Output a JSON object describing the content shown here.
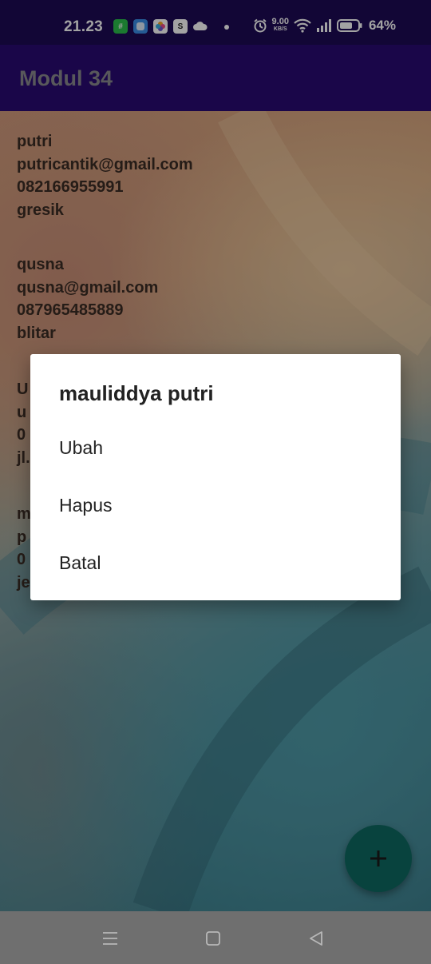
{
  "status_bar": {
    "time": "21.23",
    "net_speed_value": "9.00",
    "net_speed_unit": "KB/S",
    "battery_percent": "64%",
    "icons": [
      "app-green-icon",
      "app-blue-icon",
      "photos-icon",
      "shop-icon",
      "cloud-icon",
      "alarm-icon",
      "wifi-icon",
      "signal-icon",
      "battery-icon"
    ]
  },
  "app_bar": {
    "title": "Modul 34"
  },
  "contacts": [
    {
      "name": "putri",
      "email": "putricantik@gmail.com",
      "phone": "082166955991",
      "address": "gresik"
    },
    {
      "name": "qusna",
      "email": "qusna@gmail.com",
      "phone": "087965485889",
      "address": "blitar"
    },
    {
      "name": "U",
      "email": "u",
      "phone": "0",
      "address": "jl."
    },
    {
      "name": "m",
      "email": "p",
      "phone": "0",
      "address": "je"
    }
  ],
  "dialog": {
    "title": "mauliddya putri",
    "items": [
      "Ubah",
      "Hapus",
      "Batal"
    ]
  },
  "fab": {
    "icon": "plus-icon"
  },
  "nav_bar": {
    "icons": [
      "menu-icon",
      "home-square-icon",
      "back-triangle-icon"
    ]
  },
  "colors": {
    "status_bar": "#1d0a55",
    "app_bar": "#2a0a73",
    "fab": "#0e6a62",
    "dialog_bg": "#ffffff"
  }
}
